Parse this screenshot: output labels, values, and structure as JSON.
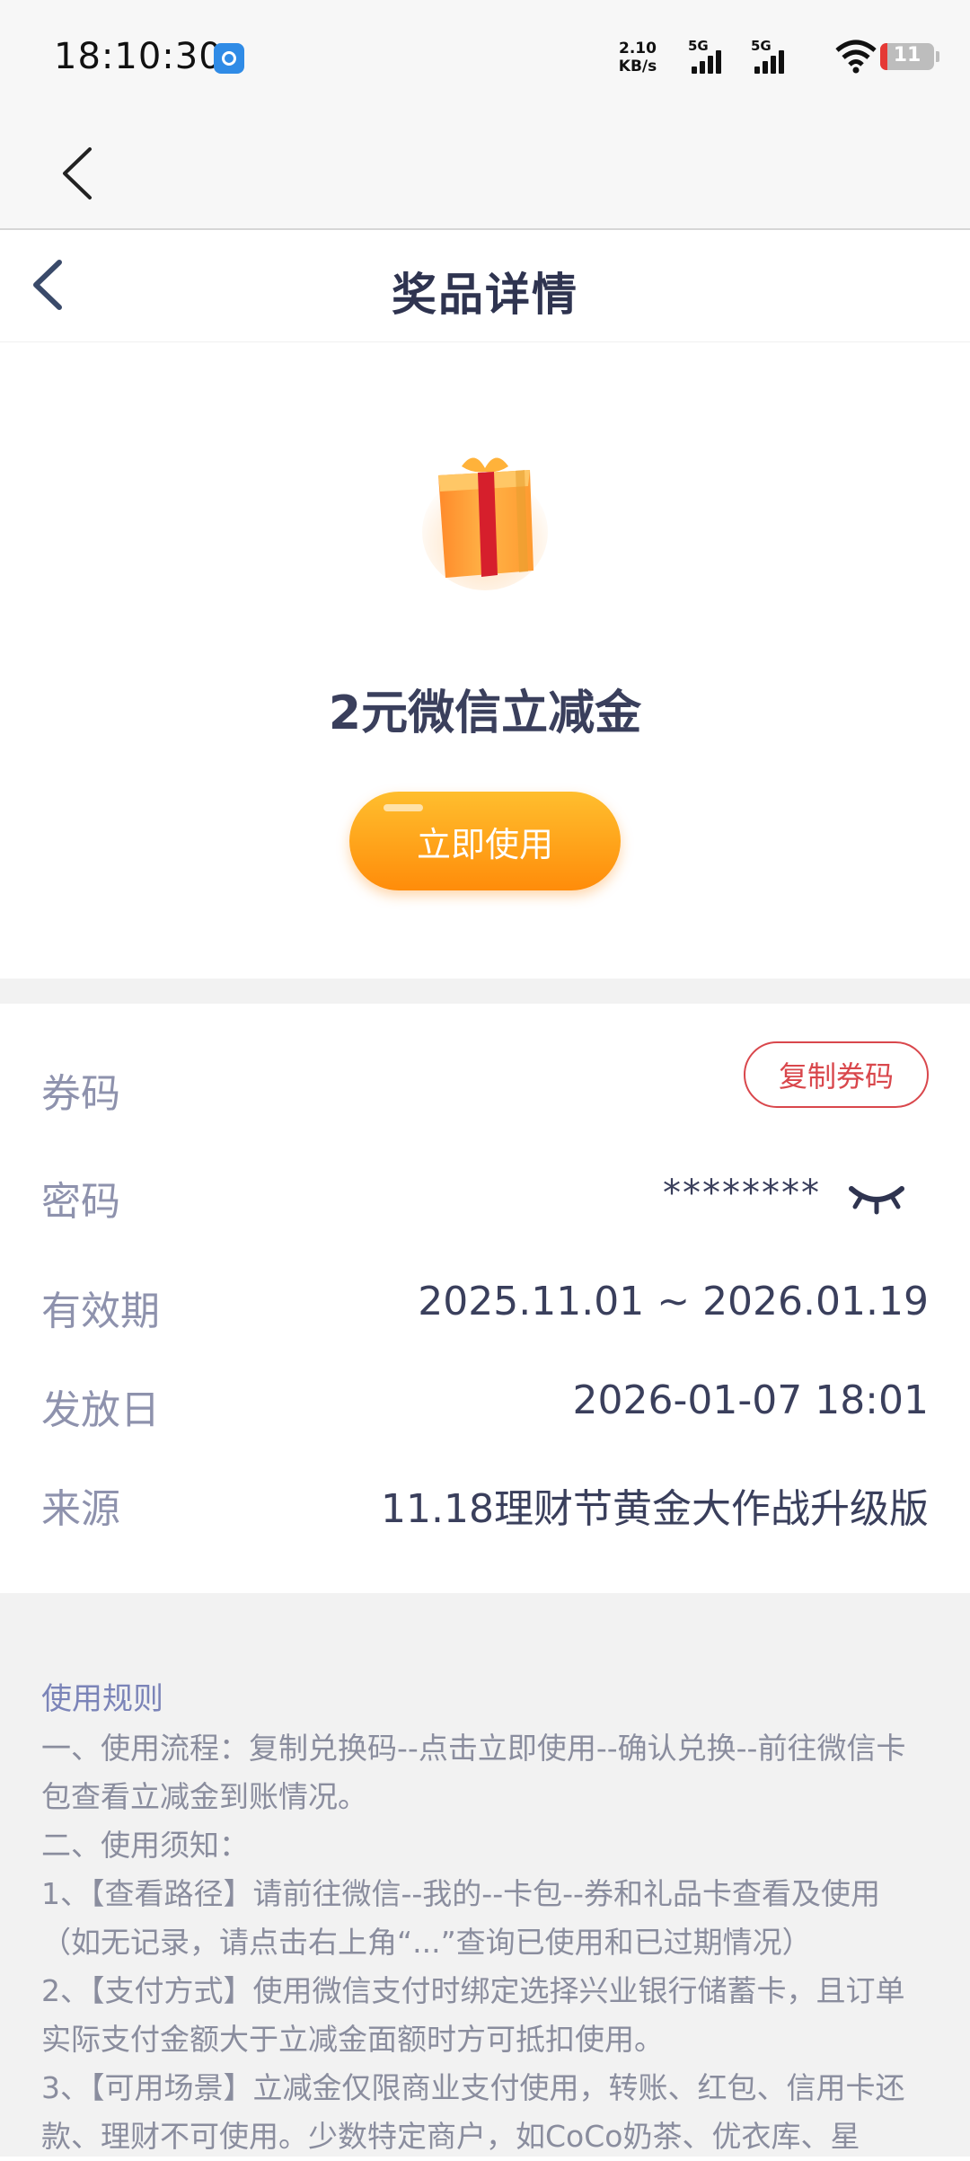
{
  "status_bar": {
    "time": "18:10:30",
    "net_speed_value": "2.10",
    "net_speed_unit": "KB/s",
    "sim1": "5G",
    "sim2": "5G",
    "battery": "11"
  },
  "header": {
    "title": "奖品详情"
  },
  "prize": {
    "name": "2元微信立减金",
    "use_button": "立即使用"
  },
  "info": {
    "code_label": "券码",
    "copy_button": "复制券码",
    "password_label": "密码",
    "password_value": "********",
    "validity_label": "有效期",
    "validity_value": "2025.11.01 ~ 2026.01.19",
    "issue_label": "发放日",
    "issue_value": "2026-01-07 18:01",
    "source_label": "来源",
    "source_value": "11.18理财节黄金大作战升级版"
  },
  "rules": {
    "title": "使用规则",
    "lines": [
      "一、使用流程：复制兑换码--点击立即使用--确认兑换--前往微信卡包查看立减金到账情况。",
      "二、使用须知：",
      "1、【查看路径】请前往微信--我的--卡包--券和礼品卡查看及使用（如无记录，请点击右上角“...”查询已使用和已过期情况）",
      "2、【支付方式】使用微信支付时绑定选择兴业银行储蓄卡，且订单实际支付金额大于立减金面额时方可抵扣使用。",
      "3、【可用场景】立减金仅限商业支付使用，转账、红包、信用卡还款、理财不可使用。少数特定商户，如CoCo奶茶、优衣库、星"
    ]
  },
  "colors": {
    "accent_orange": "#ffa31a",
    "copy_red": "#d9474c",
    "label_gray": "#8e92ad",
    "rules_title": "#7b84b8"
  }
}
